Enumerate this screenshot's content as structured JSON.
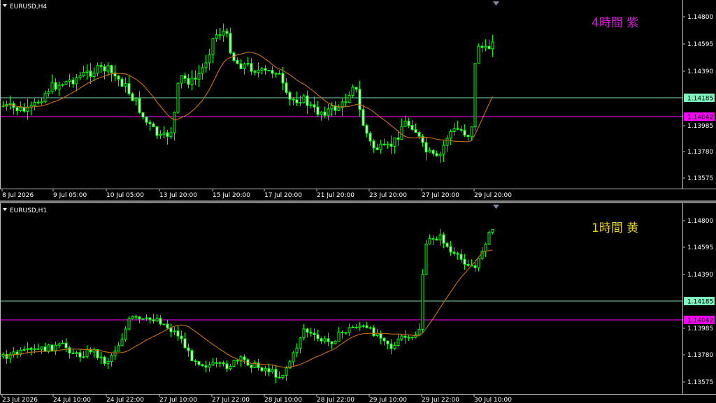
{
  "colors": {
    "background": "#000000",
    "frame": "#c0c0c0",
    "candle": "#00ff00",
    "candle_body_fill": "#d7ffd7",
    "ma_line": "#c06a10",
    "hline_green": "#7fd9b0",
    "hline_magenta": "#ff00ff",
    "price_tag_green": "#7ff5c0",
    "price_tag_magenta": "#ff00ff",
    "title_h4": "#d21ed2",
    "title_h1": "#e6d21e",
    "axis_text": "#ffffff",
    "marker_triangle": "#7f8aa0"
  },
  "panels": [
    {
      "id": "h4",
      "symbol_label": "EURUSD,H4",
      "overlay_title": "4時間  紫",
      "price_ticks": [
        "1.14800",
        "1.14595",
        "1.14390",
        "1.14185",
        "1.13985",
        "1.13780",
        "1.13575"
      ],
      "hline_green_label": "1.14185",
      "hline_magenta_label": "1.14042",
      "time_labels": [
        "8 Jul 2026",
        "9 Jul 05:00",
        "10 Jul 05:00",
        "13 Jul 20:00",
        "15 Jul 20:00",
        "17 Jul 20:00",
        "21 Jul 20:00",
        "23 Jul 20:00",
        "27 Jul 20:00",
        "29 Jul 20:00"
      ]
    },
    {
      "id": "h1",
      "symbol_label": "EURUSD,H1",
      "overlay_title": "1時間  黄",
      "price_ticks": [
        "1.14800",
        "1.14595",
        "1.14390",
        "1.14185",
        "1.13985",
        "1.13780",
        "1.13575"
      ],
      "hline_green_label": "1.14185",
      "hline_magenta_label": "1.14042",
      "time_labels": [
        "23 Jul 2026",
        "24 Jul 10:00",
        "24 Jul 22:00",
        "27 Jul 10:00",
        "27 Jul 22:00",
        "28 Jul 10:00",
        "28 Jul 22:00",
        "29 Jul 10:00",
        "29 Jul 22:00",
        "30 Jul 10:00"
      ]
    }
  ]
}
